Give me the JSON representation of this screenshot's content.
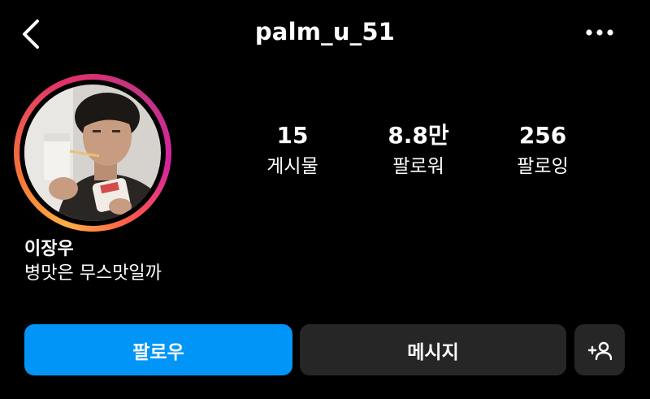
{
  "header": {
    "username": "palm_u_51"
  },
  "stats": [
    {
      "value": "15",
      "label": "게시물"
    },
    {
      "value": "8.8만",
      "label": "팔로워"
    },
    {
      "value": "256",
      "label": "팔로잉"
    }
  ],
  "profile": {
    "name": "이장우",
    "bio": "병맛은 무스맛일까"
  },
  "actions": {
    "follow": "팔로우",
    "message": "메시지"
  },
  "icons": {
    "back": "chevron-left-icon",
    "more": "more-horizontal-icon",
    "add_user": "add-person-icon"
  },
  "colors": {
    "follow_button": "#0095f6",
    "secondary_button": "#262626",
    "background": "#000000"
  }
}
